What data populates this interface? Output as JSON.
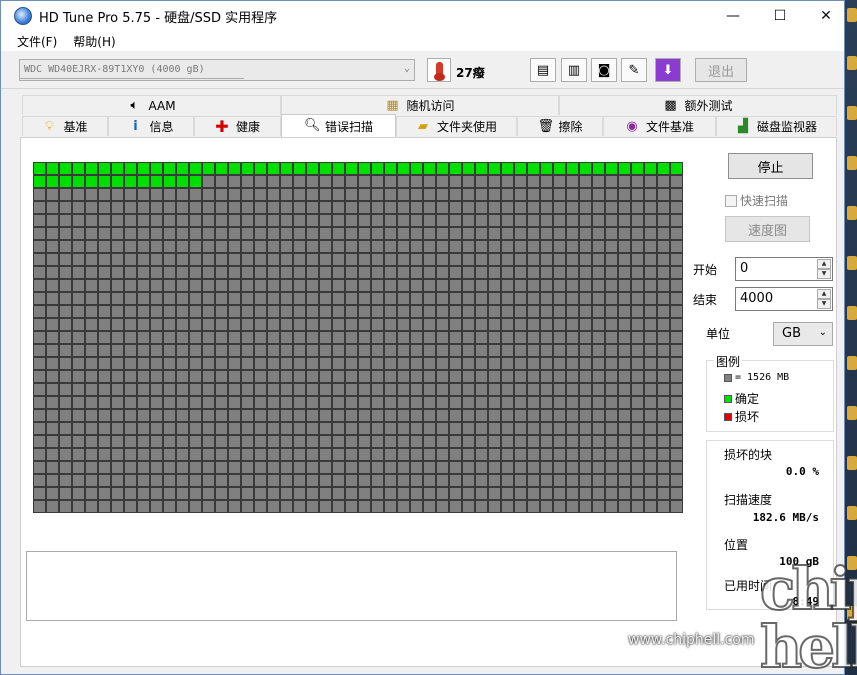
{
  "window": {
    "title": "HD Tune Pro 5.75 - 硬盘/SSD 实用程序",
    "controls": {
      "minimize": "—",
      "maximize": "☐",
      "close": "✕"
    }
  },
  "menu": {
    "items": [
      "文件(F)",
      "帮助(H)"
    ]
  },
  "toolbar": {
    "drive": "WDC WD40EJRX-89T1XY0 (4000 gB)",
    "temperature": "27癈",
    "exit_label": "退出",
    "icons": [
      "copy-text-icon",
      "copy-screen-icon",
      "camera-icon",
      "options-icon",
      "save-icon"
    ]
  },
  "tabs": {
    "row1": [
      {
        "label": "AAM",
        "icon": "speaker-icon"
      },
      {
        "label": "随机访问",
        "icon": "random-access-icon"
      },
      {
        "label": "额外测试",
        "icon": "extra-tests-icon"
      }
    ],
    "row2": [
      {
        "label": "基准",
        "icon": "bulb-icon"
      },
      {
        "label": "信息",
        "icon": "info-icon"
      },
      {
        "label": "健康",
        "icon": "health-cross-icon"
      },
      {
        "label": "错误扫描",
        "icon": "magnifier-icon",
        "active": true
      },
      {
        "label": "文件夹使用",
        "icon": "folder-icon"
      },
      {
        "label": "擦除",
        "icon": "trash-icon"
      },
      {
        "label": "文件基准",
        "icon": "file-benchmark-icon"
      },
      {
        "label": "磁盘监视器",
        "icon": "disk-monitor-icon"
      }
    ]
  },
  "scan_grid": {
    "columns": 50,
    "rows": 27,
    "completed_blocks": 63,
    "colors": {
      "pending": "#808080",
      "ok": "#00e000",
      "bad": "#e00000",
      "border": "#3a3a3a"
    }
  },
  "panel": {
    "stop_label": "停止",
    "quick_scan_label": "快速扫描",
    "speed_graph_label": "速度图",
    "start_label": "开始",
    "start_value": "0",
    "end_label": "结束",
    "end_value": "4000",
    "unit_label": "单位",
    "unit_value": "GB",
    "legend": {
      "title": "图例",
      "block_size": "= 1526 MB",
      "ok": "确定",
      "bad": "损坏"
    },
    "stats": {
      "damaged_label": "损坏的块",
      "damaged_value": "0.0 %",
      "speed_label": "扫描速度",
      "speed_value": "182.6 MB/s",
      "position_label": "位置",
      "position_value": "100 gB",
      "elapsed_label": "已用时间",
      "elapsed_value": "8:49"
    }
  },
  "watermark": {
    "logo": "chip hell",
    "url": "www.chiphell.com"
  }
}
